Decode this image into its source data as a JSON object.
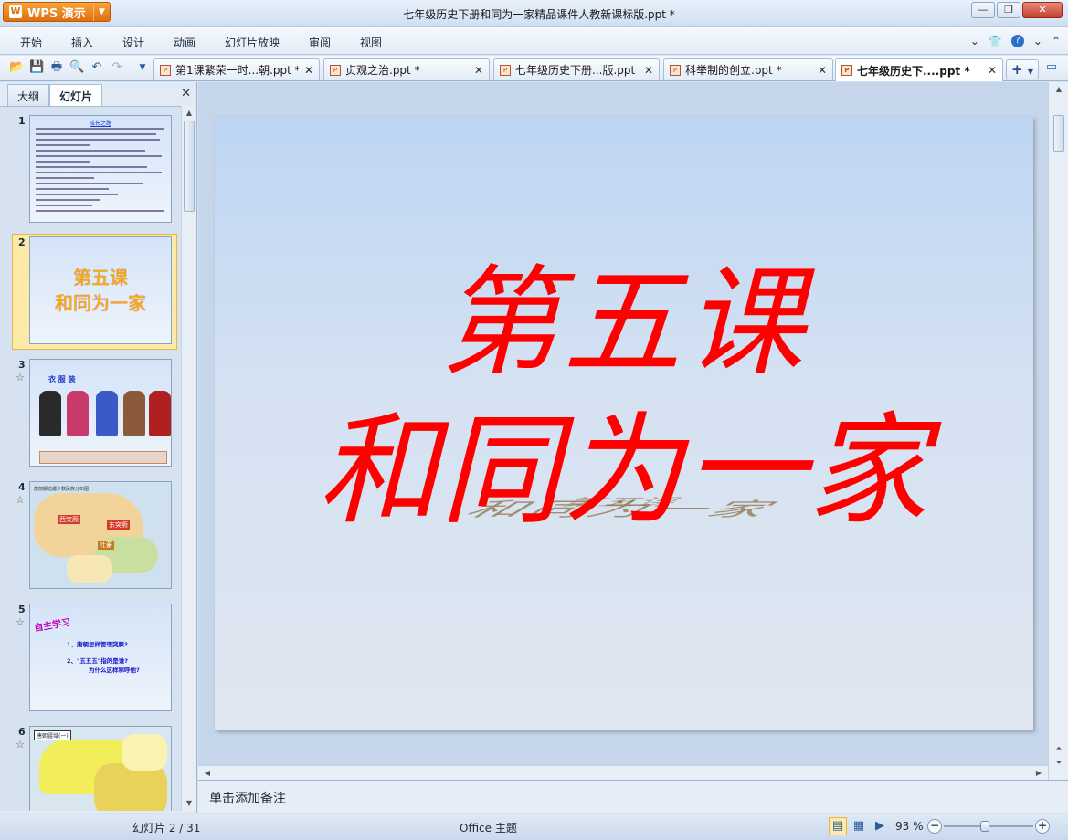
{
  "app": {
    "name": "WPS 演示",
    "window_title": "七年级历史下册和同为一家精品课件人教新课标版.ppt *"
  },
  "menu": [
    "开始",
    "插入",
    "设计",
    "动画",
    "幻灯片放映",
    "审阅",
    "视图"
  ],
  "tabs": [
    {
      "label": "第1课繁荣一时...朝.ppt *",
      "active": false
    },
    {
      "label": "贞观之治.ppt *",
      "active": false
    },
    {
      "label": "七年级历史下册...版.ppt *",
      "active": false
    },
    {
      "label": "科举制的创立.ppt *",
      "active": false
    },
    {
      "label": "七年级历史下....ppt *",
      "active": true
    }
  ],
  "left_panel": {
    "tabs": [
      "大纲",
      "幻灯片"
    ],
    "active_tab": "幻灯片",
    "thumbnails": [
      {
        "num": "1",
        "title": "成长之路",
        "has_animation": false
      },
      {
        "num": "2",
        "line1": "第五课",
        "line2": "和同为一家",
        "has_animation": false,
        "selected": true
      },
      {
        "num": "3",
        "title": "衣   服   装",
        "has_animation": true
      },
      {
        "num": "4",
        "title": "唐前期边疆少数民族分布图",
        "labels": [
          "西突厥",
          "东突厥",
          "吐蕃"
        ],
        "has_animation": true
      },
      {
        "num": "5",
        "side": "自主学习",
        "lines": [
          "1、唐朝怎样管理突厥?",
          "2、\"五五五\"指的是谁?",
          "为什么这样称呼他?"
        ],
        "has_animation": true
      },
      {
        "num": "6",
        "title": "唐朝疆域(一)",
        "has_animation": true
      }
    ]
  },
  "slide": {
    "title": "第五课",
    "subtitle": "和同为一家",
    "title_color": "#ff0000"
  },
  "notes": {
    "placeholder": "单击添加备注"
  },
  "status": {
    "slide_position": "幻灯片 2 / 31",
    "theme": "Office 主题",
    "zoom": "93 %",
    "zoom_level": 0.46
  }
}
